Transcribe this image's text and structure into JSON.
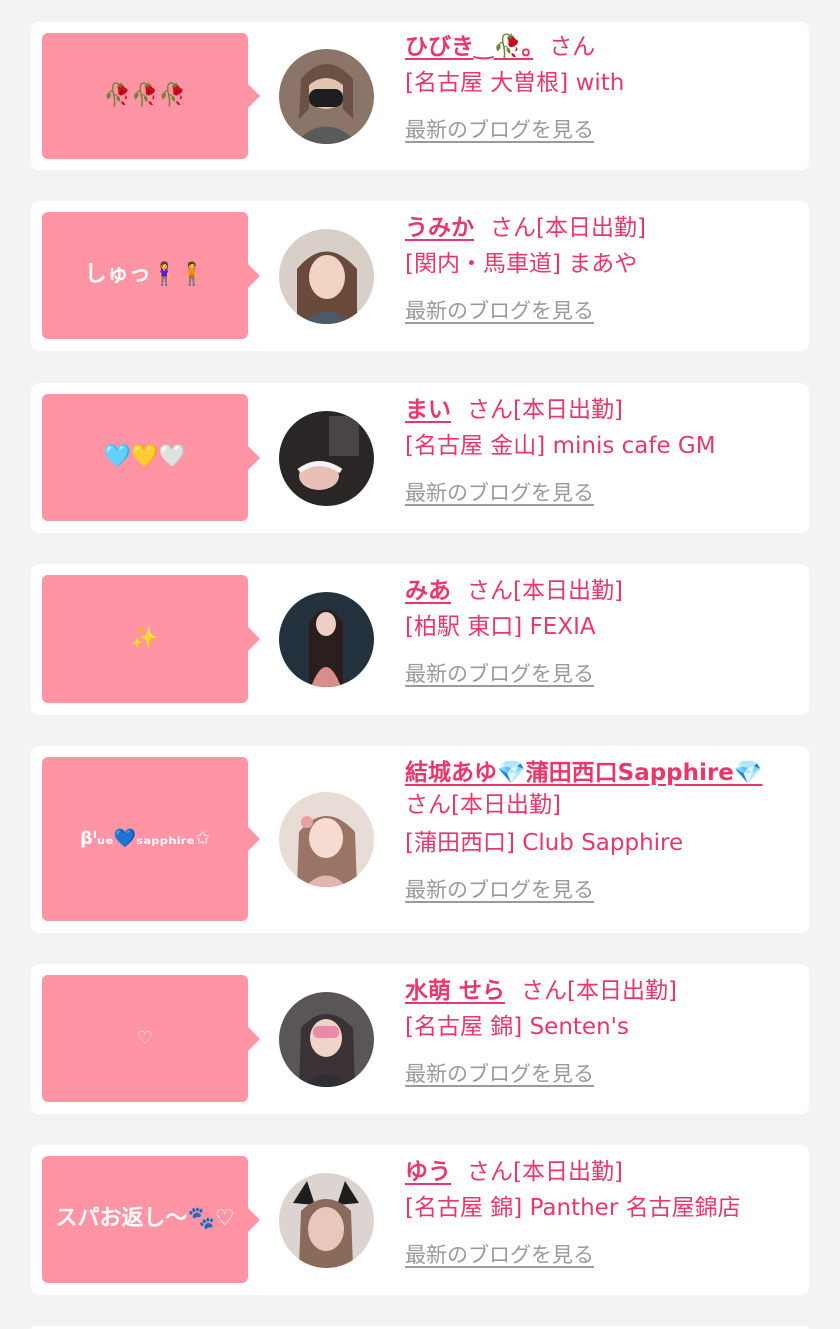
{
  "blog_link_label": "最新のブログを見る",
  "colors": {
    "accent": "#e8386a",
    "bubble": "#ff94a4",
    "link_gray": "#9a9a9a",
    "card": "#ffffff",
    "background": "#f3f3f3"
  },
  "entries": [
    {
      "bubble": "🥀🥀🥀",
      "name": "ひびき‿🥀｡",
      "san": "さん",
      "shop": "[名古屋 大曽根] with",
      "avatar": "#7a6458"
    },
    {
      "bubble": "しゅっ🧍‍♀️🧍",
      "name": "うみか",
      "san": "さん[本日出勤]",
      "shop": "[関内・馬車道] まあや",
      "avatar": "#a88a78"
    },
    {
      "bubble": "🩵💛🤍",
      "name": "まい",
      "san": "さん[本日出勤]",
      "shop": "[名古屋 金山] minis cafe GM",
      "avatar": "#3a3434"
    },
    {
      "bubble": "✨",
      "name": "みあ",
      "san": "さん[本日出勤]",
      "shop": "[柏駅 東口] FEXIA",
      "avatar": "#2c3a48"
    },
    {
      "bubble": "βˡᵤₑ💙ₛₐₚₚₕᵢᵣₑ✩",
      "name": "結城あゆ💎蒲田西口Sapphire💎",
      "san": "さん[本日出勤]",
      "shop": "[蒲田西口] Club Sapphire",
      "avatar": "#c9a79a"
    },
    {
      "bubble": "♡",
      "name": "水萌 せら",
      "san": "さん[本日出勤]",
      "shop": "[名古屋 錦] Senten's",
      "avatar": "#4f4a50"
    },
    {
      "bubble": "スパお返し〜🐾♡",
      "name": "ゆう",
      "san": "さん[本日出勤]",
      "shop": "[名古屋 錦] Panther 名古屋錦店",
      "avatar": "#b09a90"
    }
  ]
}
